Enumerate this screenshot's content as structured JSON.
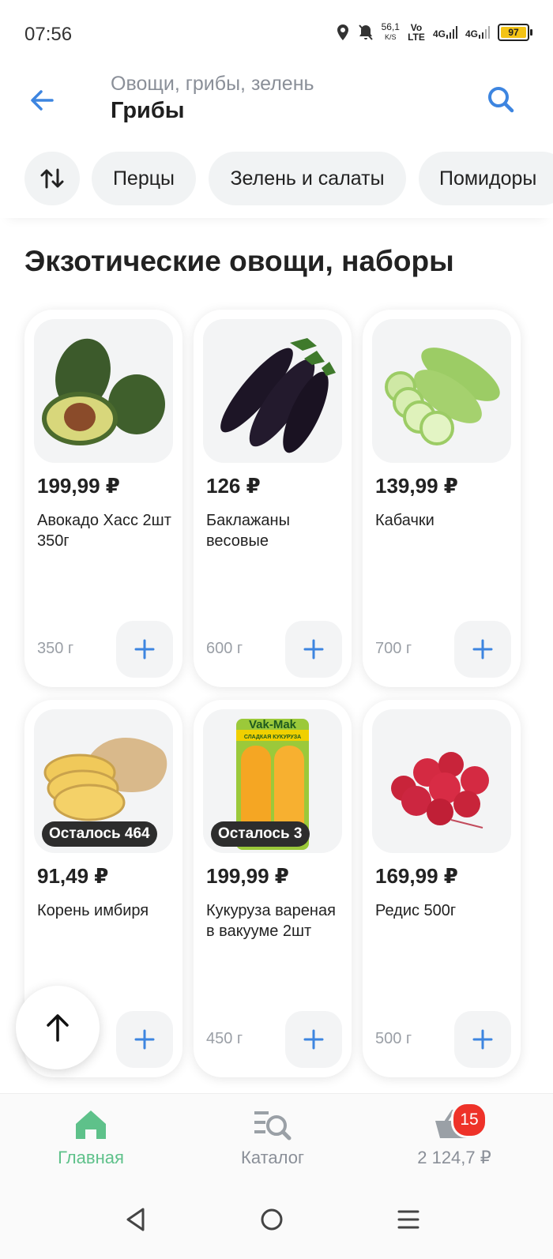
{
  "status": {
    "time": "07:56",
    "net_speed": "56,1",
    "net_unit": "K/S",
    "volte": "Vo LTE",
    "net1": "4G",
    "net2": "4G",
    "battery": "97"
  },
  "header": {
    "subtitle": "Овощи, грибы, зелень",
    "title": "Грибы"
  },
  "chips": [
    "Перцы",
    "Зелень и салаты",
    "Помидоры"
  ],
  "section_title": "Экзотические овощи, наборы",
  "products": [
    {
      "price": "199,99 ₽",
      "name": "Авокадо Хасс 2шт 350г",
      "weight": "350 г",
      "badge": "",
      "image": "avocado"
    },
    {
      "price": "126 ₽",
      "name": "Баклажаны весовые",
      "weight": "600 г",
      "badge": "",
      "image": "eggplant"
    },
    {
      "price": "139,99 ₽",
      "name": "Кабачки",
      "weight": "700 г",
      "badge": "",
      "image": "zucchini"
    },
    {
      "price": "91,49 ₽",
      "name": "Корень имбиря",
      "weight": "",
      "badge": "Осталось 464",
      "image": "ginger"
    },
    {
      "price": "199,99 ₽",
      "name": "Кукуруза вареная в вакууме 2шт",
      "weight": "450 г",
      "badge": "Осталось 3",
      "image": "corn",
      "pack_brand": "Vak-Mak",
      "pack_label": "СЛАДКАЯ КУКУРУЗА"
    },
    {
      "price": "169,99 ₽",
      "name": "Редис 500г",
      "weight": "500 г",
      "badge": "",
      "image": "radish"
    }
  ],
  "bottom_nav": {
    "home": "Главная",
    "catalog": "Каталог",
    "cart_total": "2 124,7 ₽",
    "cart_count": "15"
  },
  "colors": {
    "accent_blue": "#3d85e0",
    "accent_green": "#5ec18a",
    "badge_red": "#ee3229"
  }
}
